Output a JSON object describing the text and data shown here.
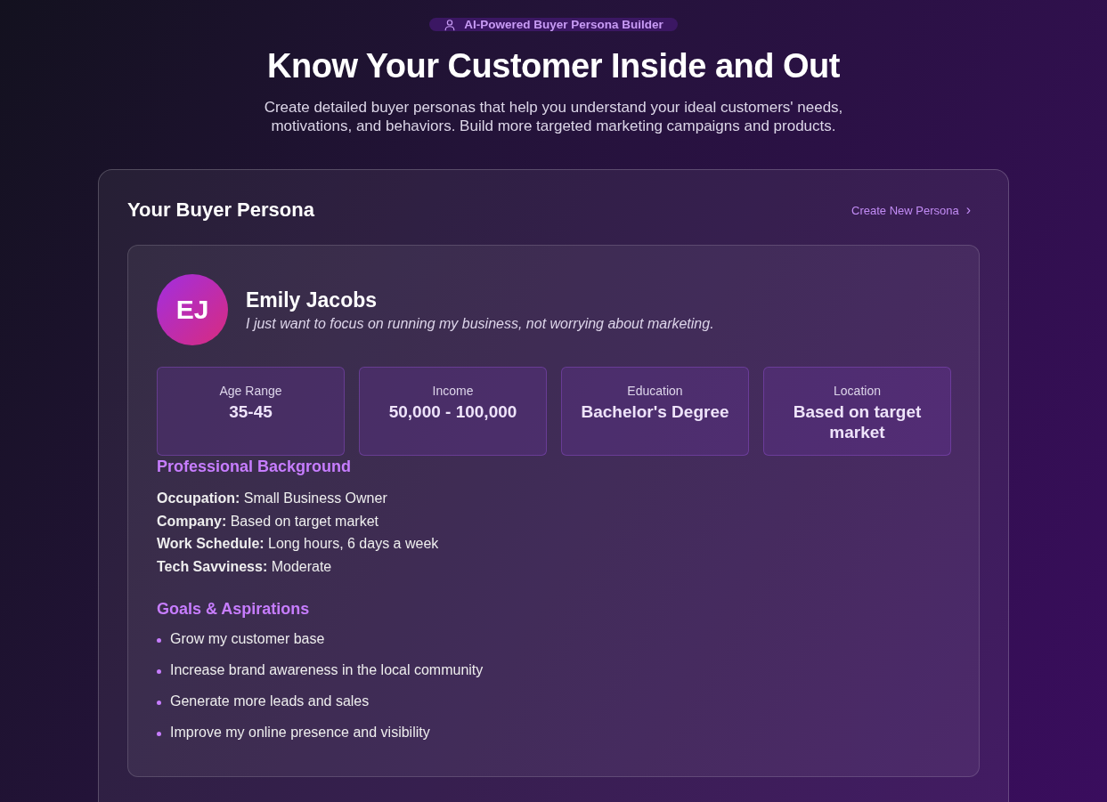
{
  "badge": {
    "label": "AI-Powered Buyer Persona Builder"
  },
  "hero": {
    "title": "Know Your Customer Inside and Out",
    "subtitle": "Create detailed buyer personas that help you understand your ideal customers' needs, motivations, and behaviors. Build more targeted marketing campaigns and products."
  },
  "panel": {
    "title": "Your Buyer Persona",
    "action": {
      "label": "Create New Persona",
      "chevron": "›"
    }
  },
  "persona": {
    "initials": "EJ",
    "name": "Emily Jacobs",
    "quote": "I just want to focus on running my business, not worrying about marketing.",
    "stats": [
      {
        "label": "Age Range",
        "value": "35-45"
      },
      {
        "label": "Income",
        "value": "50,000 - 100,000"
      },
      {
        "label": "Education",
        "value": "Bachelor's Degree"
      },
      {
        "label": "Location",
        "value": "Based on target market"
      }
    ],
    "sections": [
      {
        "kind": "details",
        "title": "Professional Background",
        "items": [
          {
            "term": "Occupation:",
            "value": "Small Business Owner"
          },
          {
            "term": "Company:",
            "value": "Based on target market"
          },
          {
            "term": "Work Schedule:",
            "value": "Long hours, 6 days a week"
          },
          {
            "term": "Tech Savviness:",
            "value": "Moderate"
          }
        ]
      },
      {
        "kind": "bullets",
        "title": "Goals & Aspirations",
        "items": [
          "Grow my customer base",
          "Increase brand awareness in the local community",
          "Generate more leads and sales",
          "Improve my online presence and visibility"
        ]
      }
    ]
  }
}
